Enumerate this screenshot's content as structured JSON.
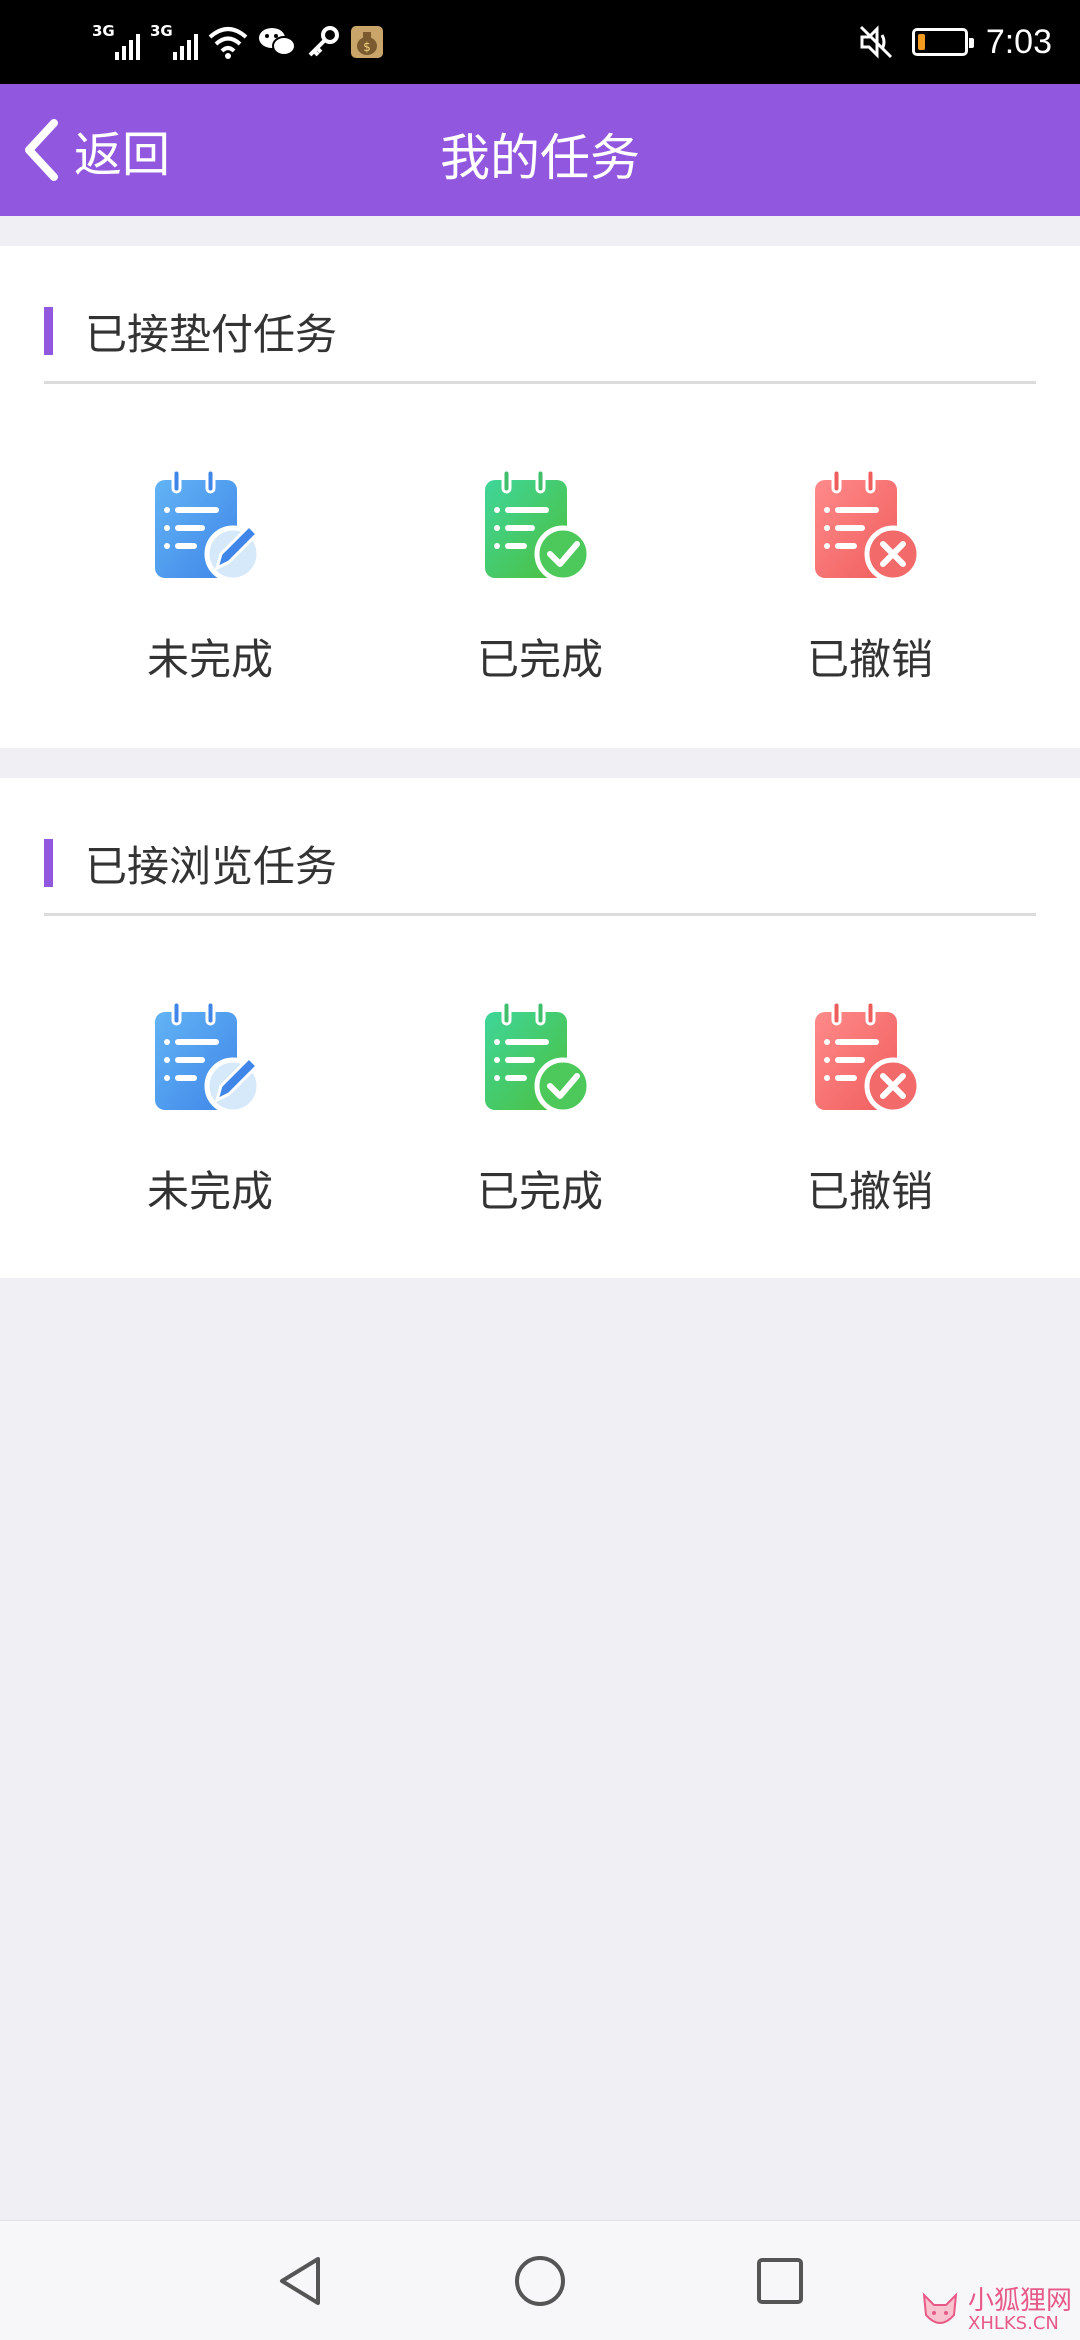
{
  "status_bar": {
    "network_1": "3G",
    "network_2": "3G",
    "time": "7:03",
    "battery_color": "#f29b1e",
    "battery_level": 0.15,
    "icons": [
      "signal-icon",
      "signal-icon",
      "wifi-icon",
      "wechat-icon",
      "key-icon",
      "money-bag-icon",
      "mute-icon",
      "battery-icon"
    ]
  },
  "header": {
    "back_label": "返回",
    "title": "我的任务",
    "color": "#9157de"
  },
  "sections": [
    {
      "title": "已接垫付任务",
      "items": [
        {
          "label": "未完成",
          "icon": "edit-note-icon"
        },
        {
          "label": "已完成",
          "icon": "check-note-icon"
        },
        {
          "label": "已撤销",
          "icon": "cancel-note-icon"
        }
      ]
    },
    {
      "title": "已接浏览任务",
      "items": [
        {
          "label": "未完成",
          "icon": "edit-note-icon"
        },
        {
          "label": "已完成",
          "icon": "check-note-icon"
        },
        {
          "label": "已撤销",
          "icon": "cancel-note-icon"
        }
      ]
    }
  ],
  "watermark": {
    "cn": "小狐狸网",
    "en": "XHLKS.CN"
  }
}
